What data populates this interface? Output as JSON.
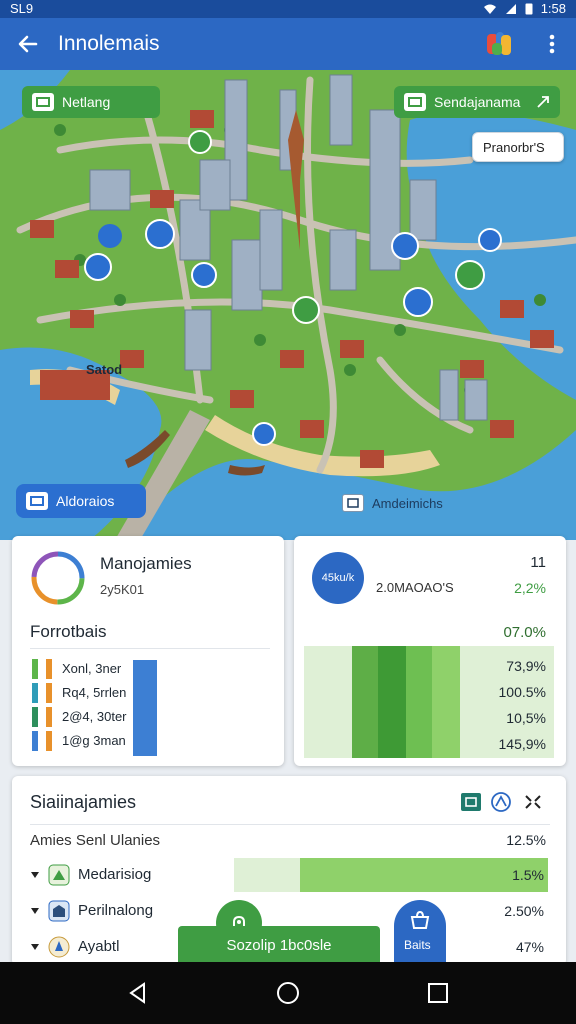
{
  "status_bar": {
    "left_text": "SL9",
    "time": "1:58"
  },
  "app_bar": {
    "title": "Innolemais"
  },
  "map": {
    "chips": {
      "top_left": "Netlang",
      "top_right": "Sendajanama",
      "right_label": "Pranorbr'S",
      "bottom_left": "Aldoraios",
      "bottom_center": "Amdeimichs",
      "map_label": "Satod"
    }
  },
  "card_left": {
    "title": "Manojamies",
    "subtitle": "2y5K01",
    "section": "Forrotbais",
    "rows": [
      {
        "label": "Xonl, 3ner",
        "color": "#5db54a"
      },
      {
        "label": "Rq4, 5rrlen",
        "color": "#e8912b"
      },
      {
        "label": "2@4, 30ter",
        "color": "#2f9cb8"
      },
      {
        "label": "1@g 3man",
        "color": "#3d7fd3"
      }
    ]
  },
  "card_right": {
    "badge": "45ku/k",
    "corner": "11",
    "subtitle": "2.0MAOAO'S",
    "subtitle_value": "2,2%",
    "header_value": "07.0%",
    "values": [
      "73,9%",
      "100.5%",
      "10,5%",
      "145,9%"
    ]
  },
  "card_bottom": {
    "title": "Siaiinajamies",
    "header_label": "Amies Senl Ulanies",
    "header_value": "12.5%",
    "rows": [
      {
        "label": "Medarisiog",
        "value": "1.5%"
      },
      {
        "label": "Perilnalong",
        "value": "2.50%"
      },
      {
        "label": "Ayabtl",
        "value": "47%"
      }
    ],
    "button_label": "Sozolip 1bc0sle",
    "fab_label": "Baits"
  },
  "colors": {
    "primary": "#2c68c3",
    "green": "#3f9d43",
    "light_green": "#8fd16a"
  }
}
